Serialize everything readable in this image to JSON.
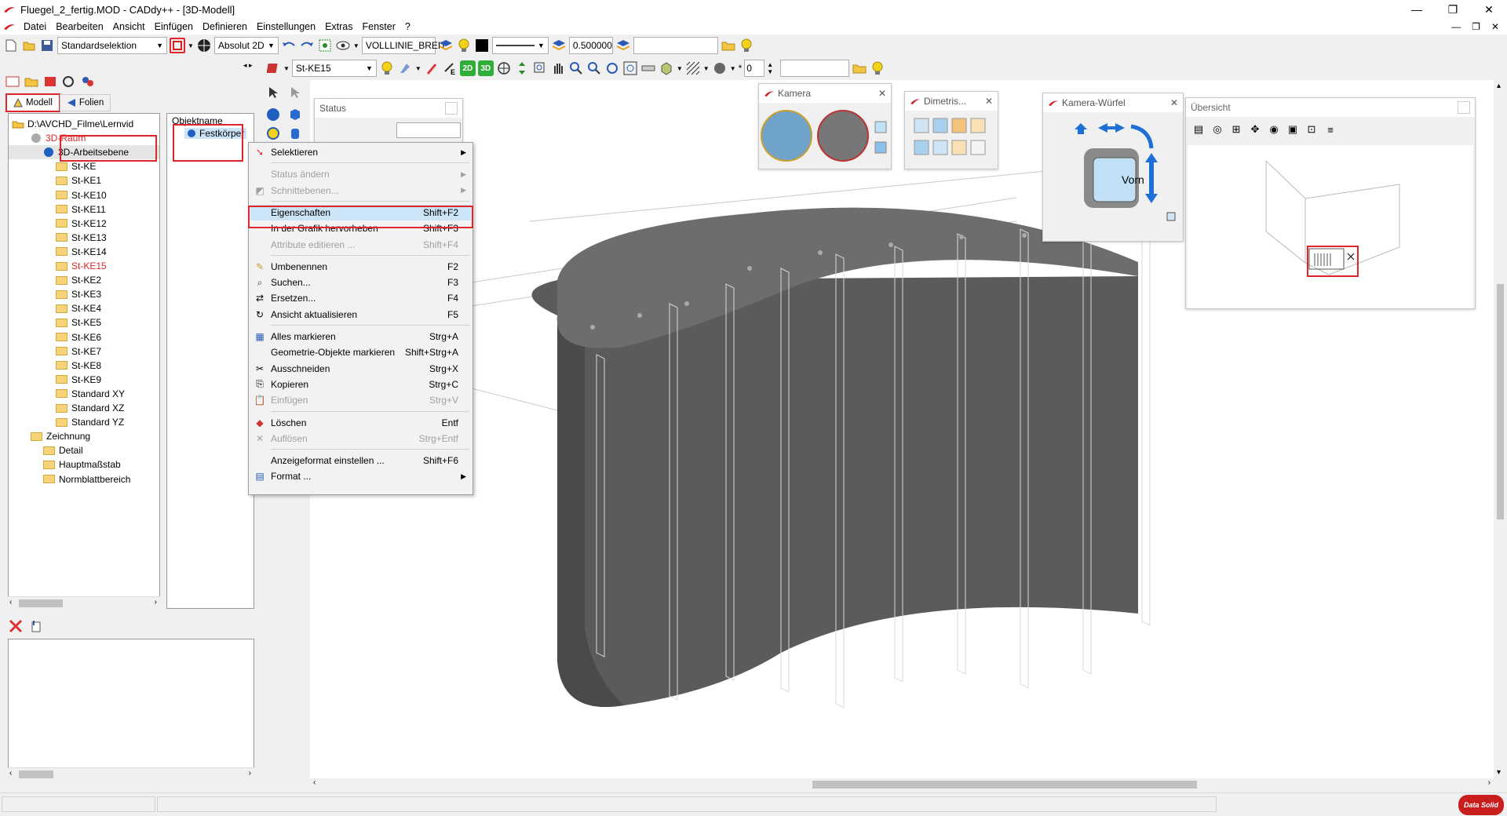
{
  "window": {
    "title": "Fluegel_2_fertig.MOD  -  CADdy++ - [3D-Modell]",
    "buttons": {
      "minimize": "—",
      "restore": "❐",
      "close": "✕"
    },
    "mdi_buttons": {
      "minimize": "—",
      "restore": "❐",
      "close": "✕"
    }
  },
  "menu": [
    "Datei",
    "Bearbeiten",
    "Ansicht",
    "Einfügen",
    "Definieren",
    "Einstellungen",
    "Extras",
    "Fenster",
    "?"
  ],
  "toolbar1": {
    "selection_mode": "Standardselektion",
    "coord_mode": "Absolut 2D",
    "linetype": "VOLLLINIE_BREIT",
    "linewidth": "0.500000",
    "text_field": ""
  },
  "toolbar2": {
    "layer": "St-KE15",
    "badge_2d": "2D",
    "badge_3d": "3D",
    "spin_value": "0",
    "text_field": ""
  },
  "left_panel": {
    "tabs": [
      "Modell",
      "Folien"
    ],
    "tree": [
      {
        "label": "D:\\AVCHD_Filme\\Lernvid",
        "level": 0,
        "type": "drive"
      },
      {
        "label": "3D-Raum",
        "level": 1,
        "type": "globe",
        "color": "#e0262a"
      },
      {
        "label": "3D-Arbeitsebene",
        "level": 2,
        "type": "globe",
        "selected": true
      },
      {
        "label": "St-KE",
        "level": 3,
        "type": "folder"
      },
      {
        "label": "St-KE1",
        "level": 3,
        "type": "folder"
      },
      {
        "label": "St-KE10",
        "level": 3,
        "type": "folder"
      },
      {
        "label": "St-KE11",
        "level": 3,
        "type": "folder"
      },
      {
        "label": "St-KE12",
        "level": 3,
        "type": "folder"
      },
      {
        "label": "St-KE13",
        "level": 3,
        "type": "folder"
      },
      {
        "label": "St-KE14",
        "level": 3,
        "type": "folder"
      },
      {
        "label": "St-KE15",
        "level": 3,
        "type": "folder",
        "color": "#e0262a"
      },
      {
        "label": "St-KE2",
        "level": 3,
        "type": "folder"
      },
      {
        "label": "St-KE3",
        "level": 3,
        "type": "folder"
      },
      {
        "label": "St-KE4",
        "level": 3,
        "type": "folder"
      },
      {
        "label": "St-KE5",
        "level": 3,
        "type": "folder"
      },
      {
        "label": "St-KE6",
        "level": 3,
        "type": "folder"
      },
      {
        "label": "St-KE7",
        "level": 3,
        "type": "folder"
      },
      {
        "label": "St-KE8",
        "level": 3,
        "type": "folder"
      },
      {
        "label": "St-KE9",
        "level": 3,
        "type": "folder"
      },
      {
        "label": "Standard XY",
        "level": 3,
        "type": "folder"
      },
      {
        "label": "Standard XZ",
        "level": 3,
        "type": "folder"
      },
      {
        "label": "Standard YZ",
        "level": 3,
        "type": "folder"
      },
      {
        "label": "Zeichnung",
        "level": 1,
        "type": "folder"
      },
      {
        "label": "Detail",
        "level": 2,
        "type": "folder"
      },
      {
        "label": "Hauptmaßstab",
        "level": 2,
        "type": "folder"
      },
      {
        "label": "Normblattbereich",
        "level": 2,
        "type": "folder"
      }
    ],
    "objlist_header": "Objektname",
    "objlist_item": "Festkörper"
  },
  "context_menu": [
    {
      "label": "Selektieren",
      "shortcut": "",
      "submenu": true,
      "disabled": false,
      "icon": "select-arrow-icon"
    },
    {
      "sep": true
    },
    {
      "label": "Status ändern",
      "shortcut": "",
      "submenu": true,
      "disabled": true
    },
    {
      "label": "Schnittebenen...",
      "shortcut": "",
      "submenu": true,
      "disabled": true,
      "icon": "plane-icon"
    },
    {
      "sep": true
    },
    {
      "label": "Eigenschaften",
      "shortcut": "Shift+F2",
      "disabled": false,
      "highlight": true
    },
    {
      "label": "In der Grafik hervorheben",
      "shortcut": "Shift+F3",
      "disabled": false
    },
    {
      "label": "Attribute editieren ...",
      "shortcut": "Shift+F4",
      "disabled": true
    },
    {
      "sep": true
    },
    {
      "label": "Umbenennen",
      "shortcut": "F2",
      "disabled": false,
      "icon": "pencil-icon"
    },
    {
      "label": "Suchen...",
      "shortcut": "F3",
      "disabled": false,
      "icon": "binoculars-icon"
    },
    {
      "label": "Ersetzen...",
      "shortcut": "F4",
      "disabled": false,
      "icon": "replace-icon"
    },
    {
      "label": "Ansicht aktualisieren",
      "shortcut": "F5",
      "disabled": false,
      "icon": "refresh-icon"
    },
    {
      "sep": true
    },
    {
      "label": "Alles markieren",
      "shortcut": "Strg+A",
      "disabled": false,
      "icon": "select-all-icon"
    },
    {
      "label": "Geometrie-Objekte markieren",
      "shortcut": "Shift+Strg+A",
      "disabled": false
    },
    {
      "label": "Ausschneiden",
      "shortcut": "Strg+X",
      "disabled": false,
      "icon": "scissors-icon"
    },
    {
      "label": "Kopieren",
      "shortcut": "Strg+C",
      "disabled": false,
      "icon": "copy-icon"
    },
    {
      "label": "Einfügen",
      "shortcut": "Strg+V",
      "disabled": true,
      "icon": "paste-icon"
    },
    {
      "sep": true
    },
    {
      "label": "Löschen",
      "shortcut": "Entf",
      "disabled": false,
      "icon": "eraser-icon"
    },
    {
      "label": "Auflösen",
      "shortcut": "Strg+Entf",
      "disabled": true,
      "icon": "dissolve-icon"
    },
    {
      "sep": true
    },
    {
      "label": "Anzeigeformat einstellen ...",
      "shortcut": "Shift+F6",
      "disabled": false
    },
    {
      "label": "Format ...",
      "shortcut": "",
      "submenu": true,
      "disabled": false,
      "icon": "format-icon"
    }
  ],
  "floating": {
    "status": "Status",
    "kamera": "Kamera",
    "dimetrisch": "Dimetris...",
    "wuerfel": "Kamera-Würfel",
    "cube_face": "Vorn",
    "uebersicht": "Übersicht"
  },
  "brand": "Data Solid",
  "colors": {
    "accent_red": "#e0262a",
    "model_gray": "#5a5a5a",
    "highlight_blue": "#cce4f7"
  }
}
